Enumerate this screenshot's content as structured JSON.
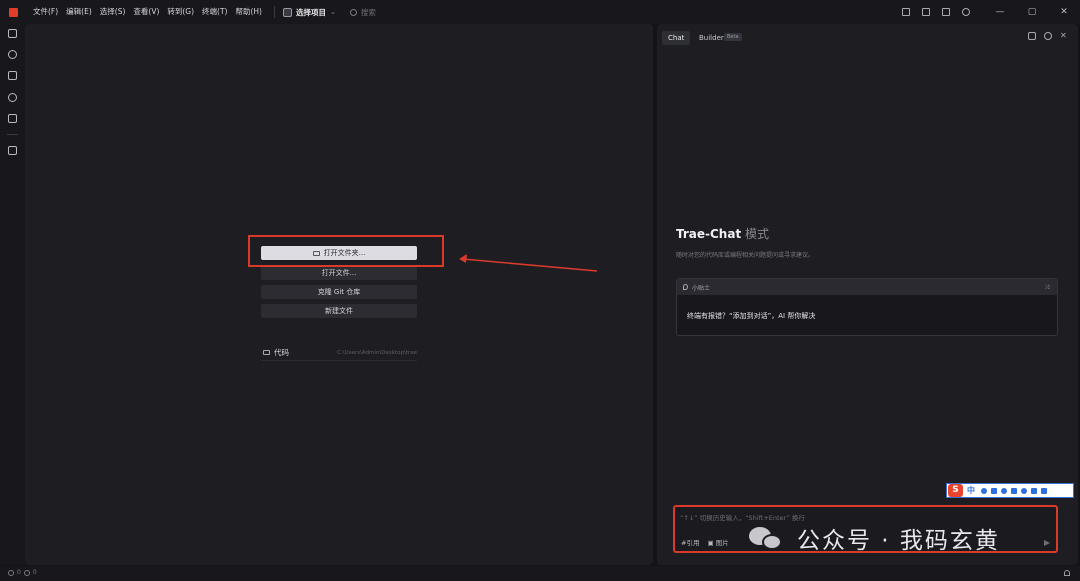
{
  "titlebar": {
    "menu": [
      "文件(F)",
      "编辑(E)",
      "选择(S)",
      "查看(V)",
      "转到(G)",
      "终端(T)",
      "帮助(H)"
    ],
    "project_label": "选择项目",
    "search_label": "搜索",
    "window_controls": [
      "—",
      "▢",
      "✕"
    ]
  },
  "editor": {
    "buttons": {
      "open_folder": "打开文件夹...",
      "open_file": "打开文件...",
      "clone_git": "克隆 Git 仓库",
      "new_file": "新建文件"
    },
    "recent": {
      "name": "代码",
      "path": "C:\\Users\\Admin\\Desktop\\trae"
    }
  },
  "chat": {
    "tabs": {
      "chat": "Chat",
      "builder": "Builder"
    },
    "beta_badge": "Beta",
    "title_main": "Trae-Chat",
    "title_mode": "模式",
    "subtitle": "随时对您的代码库或编程相关问题提问或寻求建议。",
    "tip": {
      "label": "小贴士",
      "body": "终端有报错？“添加到对话”，AI 帮你解决"
    },
    "input": {
      "placeholder": "“↑↓” 切换历史输入，“Shift+Enter” 换行",
      "quote": "#引用",
      "image": "图片"
    }
  },
  "ime": {
    "logo": "S",
    "mode": "中"
  },
  "watermark": "公众号 · 我码玄黄",
  "status": {
    "errors": "0",
    "warnings": "0"
  },
  "colors": {
    "accent_red": "#d93a2b",
    "ime_blue": "#2d6fe0"
  }
}
